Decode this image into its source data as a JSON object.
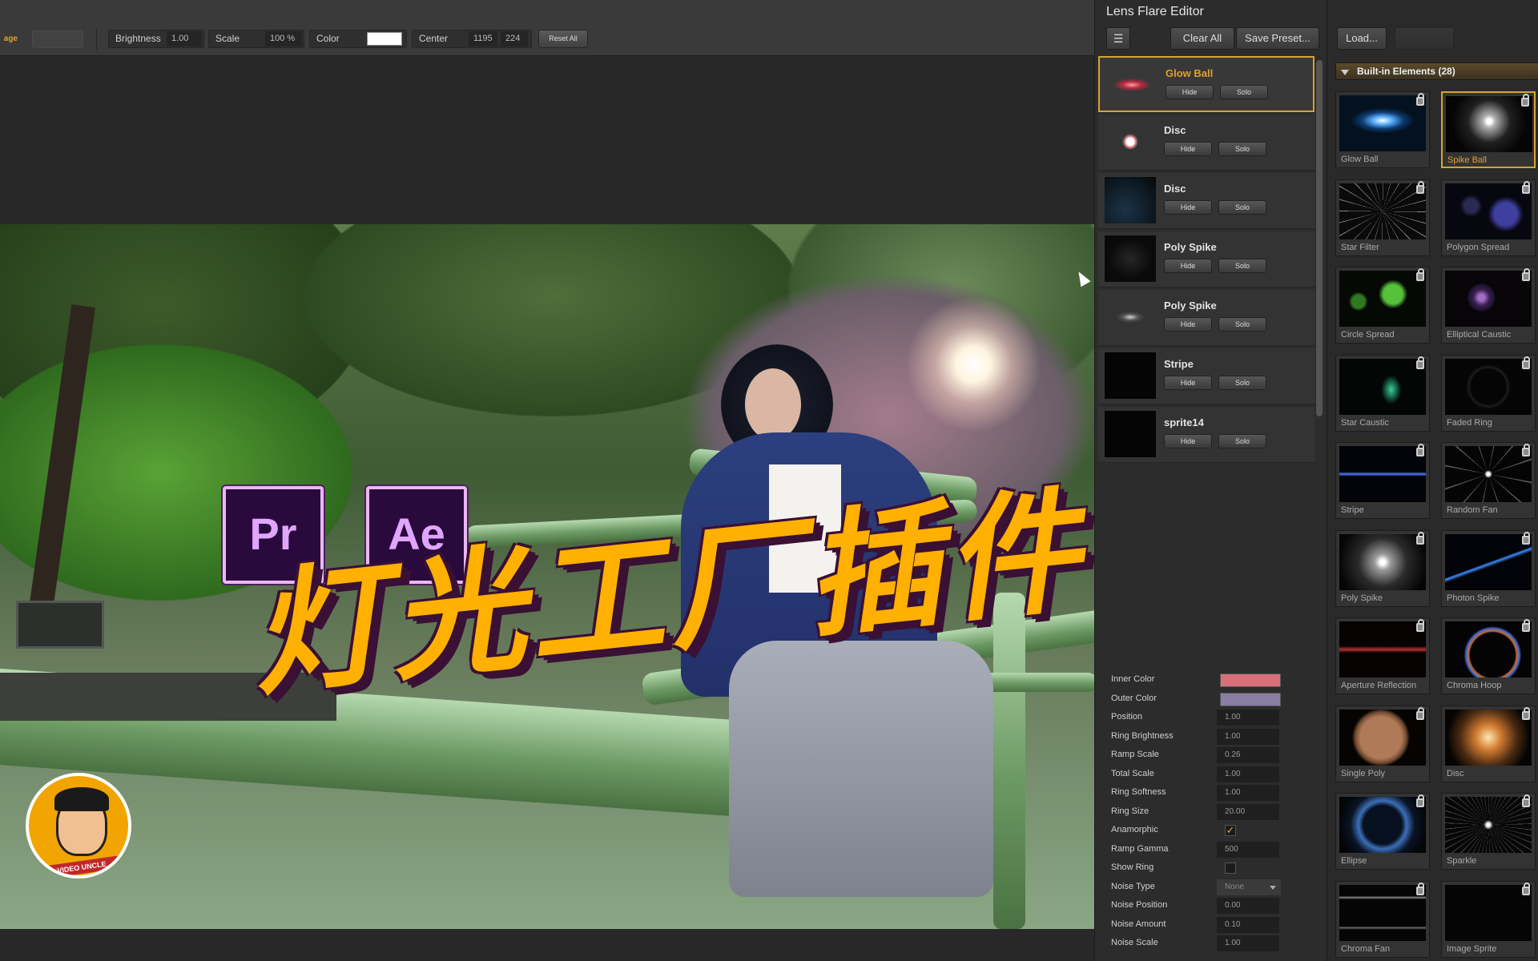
{
  "toolbar": {
    "active_tab": "age",
    "brightness_label": "Brightness",
    "brightness_value": "1.00",
    "scale_label": "Scale",
    "scale_value": "100 %",
    "color_label": "Color",
    "color_value": "#ffffff",
    "center_label": "Center",
    "center_x": "1195",
    "center_y": "224",
    "reset_label": "Reset All"
  },
  "viewport": {
    "overlay_title": "灯光工厂插件",
    "logo_pr": "Pr",
    "logo_ae": "Ae",
    "avatar_tag": "VIDEO UNCLE"
  },
  "lens_panel": {
    "title": "Lens Flare Editor",
    "menu_icon": "menu-icon",
    "clear_label": "Clear All",
    "save_label": "Save Preset...",
    "elements": [
      {
        "name": "Glow Ball",
        "hide": "Hide",
        "solo": "Solo",
        "selected": true,
        "thumb": "glow"
      },
      {
        "name": "Disc",
        "hide": "Hide",
        "solo": "Solo",
        "selected": false,
        "thumb": "dot"
      },
      {
        "name": "Disc",
        "hide": "Hide",
        "solo": "Solo",
        "selected": false,
        "thumb": "blue"
      },
      {
        "name": "Poly Spike",
        "hide": "Hide",
        "solo": "Solo",
        "selected": false,
        "thumb": "faint"
      },
      {
        "name": "Poly Spike",
        "hide": "Hide",
        "solo": "Solo",
        "selected": false,
        "thumb": "soft"
      },
      {
        "name": "Stripe",
        "hide": "Hide",
        "solo": "Solo",
        "selected": false,
        "thumb": "black"
      },
      {
        "name": "sprite14",
        "hide": "Hide",
        "solo": "Solo",
        "selected": false,
        "thumb": "black"
      }
    ],
    "properties": [
      {
        "label": "Inner Color",
        "type": "color",
        "value": "#d8707a"
      },
      {
        "label": "Outer Color",
        "type": "color",
        "value": "#8a7ea4"
      },
      {
        "label": "Position",
        "type": "number",
        "value": "1.00"
      },
      {
        "label": "Ring Brightness",
        "type": "number",
        "value": "1.00"
      },
      {
        "label": "Ramp Scale",
        "type": "number",
        "value": "0.26"
      },
      {
        "label": "Total Scale",
        "type": "number",
        "value": "1.00"
      },
      {
        "label": "Ring Softness",
        "type": "number",
        "value": "1.00"
      },
      {
        "label": "Ring Size",
        "type": "number",
        "value": "20.00"
      },
      {
        "label": "Anamorphic",
        "type": "checkbox",
        "checked": true
      },
      {
        "label": "Ramp Gamma",
        "type": "number",
        "value": "500"
      },
      {
        "label": "Show Ring",
        "type": "checkbox",
        "checked": false
      },
      {
        "label": "Noise Type",
        "type": "select",
        "value": "None"
      },
      {
        "label": "Noise Position",
        "type": "number",
        "value": "0.00"
      },
      {
        "label": "Noise Amount",
        "type": "number",
        "value": "0.10"
      },
      {
        "label": "Noise Scale",
        "type": "number",
        "value": "1.00"
      }
    ]
  },
  "library": {
    "load_label": "Load...",
    "header": "Built-in Elements (28)",
    "tiles": [
      {
        "name": "Glow Ball",
        "thumb": "glowball",
        "selected": false
      },
      {
        "name": "Spike Ball",
        "thumb": "spikeball",
        "selected": true
      },
      {
        "name": "Star Filter",
        "thumb": "star",
        "selected": false
      },
      {
        "name": "Polygon Spread",
        "thumb": "polyspread",
        "selected": false
      },
      {
        "name": "Circle Spread",
        "thumb": "circlespread",
        "selected": false
      },
      {
        "name": "Elliptical Caustic",
        "thumb": "ellcaustic",
        "selected": false
      },
      {
        "name": "Star Caustic",
        "thumb": "starcaustic",
        "selected": false
      },
      {
        "name": "Faded Ring",
        "thumb": "fadedring",
        "selected": false
      },
      {
        "name": "Stripe",
        "thumb": "stripe",
        "selected": false
      },
      {
        "name": "Random Fan",
        "thumb": "randomfan",
        "selected": false
      },
      {
        "name": "Poly Spike",
        "thumb": "polyspike",
        "selected": false
      },
      {
        "name": "Photon Spike",
        "thumb": "photon",
        "selected": false
      },
      {
        "name": "Aperture Reflection",
        "thumb": "aperture",
        "selected": false
      },
      {
        "name": "Chroma Hoop",
        "thumb": "hoop",
        "selected": false
      },
      {
        "name": "Single Poly",
        "thumb": "singlepoly",
        "selected": false
      },
      {
        "name": "Disc",
        "thumb": "disc",
        "selected": false
      },
      {
        "name": "Ellipse",
        "thumb": "ellipse",
        "selected": false
      },
      {
        "name": "Sparkle",
        "thumb": "sparkle",
        "selected": false
      },
      {
        "name": "Chroma Fan",
        "thumb": "chromafan",
        "selected": false
      },
      {
        "name": "Image Sprite",
        "thumb": "black",
        "selected": false
      }
    ]
  },
  "colors": {
    "accent": "#d6a430",
    "title_yellow": "#ffb000",
    "title_outline": "#3a1034"
  }
}
